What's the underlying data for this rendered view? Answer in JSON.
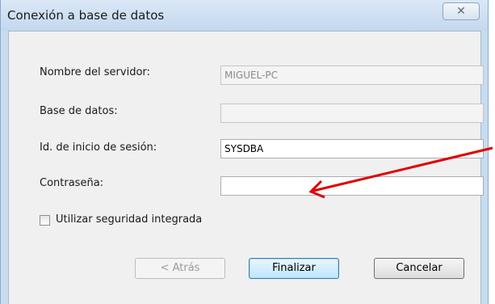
{
  "window": {
    "title": "Conexión a base de datos",
    "close_glyph": "☒"
  },
  "form": {
    "server_label": "Nombre del servidor:",
    "server_value": "MIGUEL-PC",
    "database_label": "Base de datos:",
    "database_value": "",
    "login_label": "Id. de inicio de sesión:",
    "login_value": "SYSDBA",
    "password_label": "Contraseña:",
    "password_value": "",
    "integrated_security_label": "Utilizar seguridad integrada",
    "integrated_security_checked": false
  },
  "buttons": {
    "back_label": "< Atrás",
    "finish_label": "Finalizar",
    "cancel_label": "Cancelar"
  },
  "colors": {
    "annotation_arrow": "#e00000",
    "window_frame": "#c8dcf0",
    "client_bg": "#f0f0f0"
  }
}
